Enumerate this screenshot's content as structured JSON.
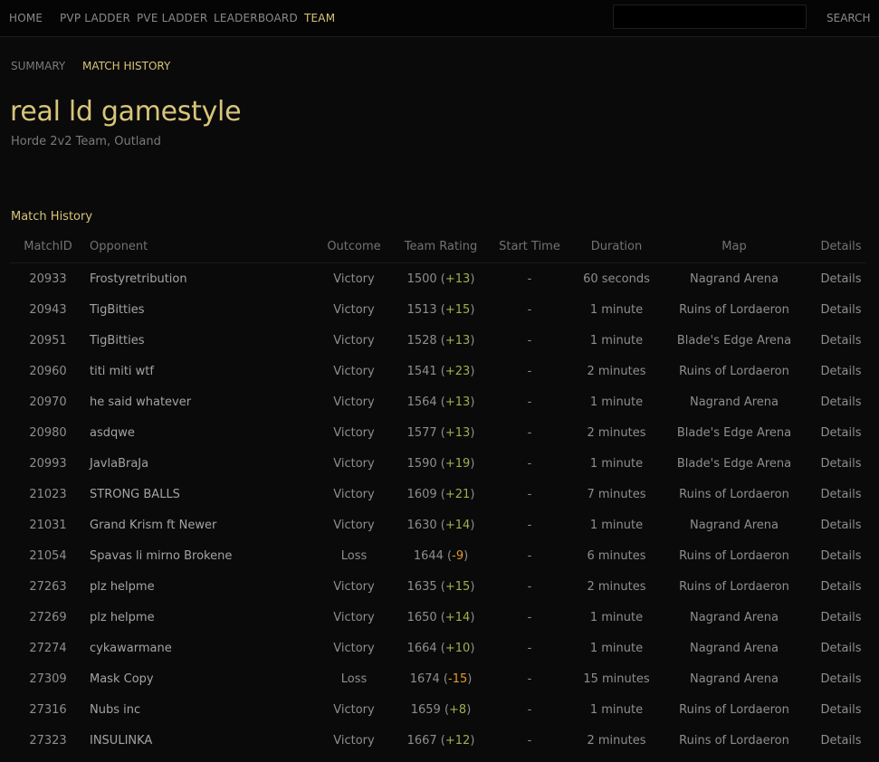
{
  "nav": {
    "items": [
      {
        "label": "HOME",
        "active": false
      },
      {
        "label": "PVP LADDER",
        "active": false
      },
      {
        "label": "PVE LADDER",
        "active": false
      },
      {
        "label": "LEADERBOARD",
        "active": false
      },
      {
        "label": "TEAM",
        "active": true
      }
    ],
    "search_value": "",
    "search_button": "SEARCH"
  },
  "subnav": {
    "items": [
      {
        "label": "SUMMARY",
        "active": false
      },
      {
        "label": "MATCH HISTORY",
        "active": true
      }
    ]
  },
  "team": {
    "name": "real ld gamestyle",
    "subtitle": "Horde 2v2 Team, Outland"
  },
  "section": {
    "title": "Match History"
  },
  "table": {
    "headers": [
      "MatchID",
      "Opponent",
      "Outcome",
      "Team Rating",
      "Start Time",
      "Duration",
      "Map",
      "Details"
    ],
    "rows": [
      {
        "id": "20933",
        "opponent": "Frostyretribution",
        "outcome": "Victory",
        "rating": "1500",
        "delta": "+13",
        "start": "-",
        "duration": "60 seconds",
        "map": "Nagrand Arena",
        "details": "Details"
      },
      {
        "id": "20943",
        "opponent": "TigBitties",
        "outcome": "Victory",
        "rating": "1513",
        "delta": "+15",
        "start": "-",
        "duration": "1 minute",
        "map": "Ruins of Lordaeron",
        "details": "Details"
      },
      {
        "id": "20951",
        "opponent": "TigBitties",
        "outcome": "Victory",
        "rating": "1528",
        "delta": "+13",
        "start": "-",
        "duration": "1 minute",
        "map": "Blade's Edge Arena",
        "details": "Details"
      },
      {
        "id": "20960",
        "opponent": "titi miti wtf",
        "outcome": "Victory",
        "rating": "1541",
        "delta": "+23",
        "start": "-",
        "duration": "2 minutes",
        "map": "Ruins of Lordaeron",
        "details": "Details"
      },
      {
        "id": "20970",
        "opponent": "he said whatever",
        "outcome": "Victory",
        "rating": "1564",
        "delta": "+13",
        "start": "-",
        "duration": "1 minute",
        "map": "Nagrand Arena",
        "details": "Details"
      },
      {
        "id": "20980",
        "opponent": "asdqwe",
        "outcome": "Victory",
        "rating": "1577",
        "delta": "+13",
        "start": "-",
        "duration": "2 minutes",
        "map": "Blade's Edge Arena",
        "details": "Details"
      },
      {
        "id": "20993",
        "opponent": "JavlaBraJa",
        "outcome": "Victory",
        "rating": "1590",
        "delta": "+19",
        "start": "-",
        "duration": "1 minute",
        "map": "Blade's Edge Arena",
        "details": "Details"
      },
      {
        "id": "21023",
        "opponent": "STRONG BALLS",
        "outcome": "Victory",
        "rating": "1609",
        "delta": "+21",
        "start": "-",
        "duration": "7 minutes",
        "map": "Ruins of Lordaeron",
        "details": "Details"
      },
      {
        "id": "21031",
        "opponent": "Grand Krism ft Newer",
        "outcome": "Victory",
        "rating": "1630",
        "delta": "+14",
        "start": "-",
        "duration": "1 minute",
        "map": "Nagrand Arena",
        "details": "Details"
      },
      {
        "id": "21054",
        "opponent": "Spavas li mirno Brokene",
        "outcome": "Loss",
        "rating": "1644",
        "delta": "-9",
        "start": "-",
        "duration": "6 minutes",
        "map": "Ruins of Lordaeron",
        "details": "Details"
      },
      {
        "id": "27263",
        "opponent": "plz helpme",
        "outcome": "Victory",
        "rating": "1635",
        "delta": "+15",
        "start": "-",
        "duration": "2 minutes",
        "map": "Ruins of Lordaeron",
        "details": "Details"
      },
      {
        "id": "27269",
        "opponent": "plz helpme",
        "outcome": "Victory",
        "rating": "1650",
        "delta": "+14",
        "start": "-",
        "duration": "1 minute",
        "map": "Nagrand Arena",
        "details": "Details"
      },
      {
        "id": "27274",
        "opponent": "cykawarmane",
        "outcome": "Victory",
        "rating": "1664",
        "delta": "+10",
        "start": "-",
        "duration": "1 minute",
        "map": "Nagrand Arena",
        "details": "Details"
      },
      {
        "id": "27309",
        "opponent": "Mask Copy",
        "outcome": "Loss",
        "rating": "1674",
        "delta": "-15",
        "start": "-",
        "duration": "15 minutes",
        "map": "Nagrand Arena",
        "details": "Details"
      },
      {
        "id": "27316",
        "opponent": "Nubs inc",
        "outcome": "Victory",
        "rating": "1659",
        "delta": "+8",
        "start": "-",
        "duration": "1 minute",
        "map": "Ruins of Lordaeron",
        "details": "Details"
      },
      {
        "id": "27323",
        "opponent": "INSULINKA",
        "outcome": "Victory",
        "rating": "1667",
        "delta": "+12",
        "start": "-",
        "duration": "2 minutes",
        "map": "Ruins of Lordaeron",
        "details": "Details"
      }
    ]
  },
  "colors": {
    "accent": "#d8c47a",
    "positive_delta": "#9fb04a",
    "negative_delta": "#e09a2a",
    "background": "#0a0a0a"
  }
}
